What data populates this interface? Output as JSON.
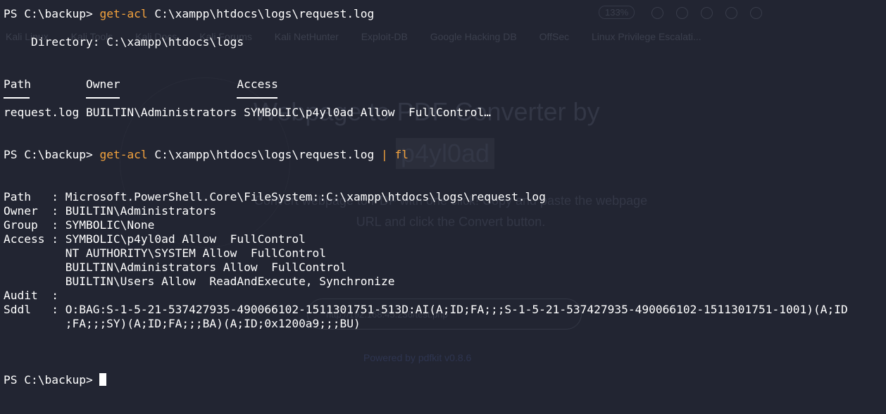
{
  "prompt": "PS C:\\backup> ",
  "command1": {
    "cmdlet": "get-acl",
    "arg": " C:\\xampp\\htdocs\\logs\\request.log"
  },
  "directory_line": "    Directory: C:\\xampp\\htdocs\\logs",
  "table": {
    "headers": [
      "Path",
      "Owner",
      "Access"
    ],
    "row": "request.log BUILTIN\\Administrators SYMBOLIC\\p4yl0ad Allow  FullControl…"
  },
  "command2": {
    "cmdlet": "get-acl",
    "arg": " C:\\xampp\\htdocs\\logs\\request.log ",
    "pipe": "|",
    "format": " fl"
  },
  "fl_output": [
    "Path   : Microsoft.PowerShell.Core\\FileSystem::C:\\xampp\\htdocs\\logs\\request.log",
    "Owner  : BUILTIN\\Administrators",
    "Group  : SYMBOLIC\\None",
    "Access : SYMBOLIC\\p4yl0ad Allow  FullControl",
    "         NT AUTHORITY\\SYSTEM Allow  FullControl",
    "         BUILTIN\\Administrators Allow  FullControl",
    "         BUILTIN\\Users Allow  ReadAndExecute, Synchronize",
    "Audit  :",
    "Sddl   : O:BAG:S-1-5-21-537427935-490066102-1511301751-513D:AI(A;ID;FA;;;S-1-5-21-537427935-490066102-1511301751-1001)(A;ID",
    "         ;FA;;;SY)(A;ID;FA;;;BA)(A;ID;0x1200a9;;;BU)"
  ],
  "background_browser": {
    "zoom": "133%",
    "bookmarks": [
      "Kali Linux",
      "Kali Tools",
      "Kali Docs",
      "Kali Forums",
      "Kali NetHunter",
      "Exploit-DB",
      "Google Hacking DB",
      "OffSec",
      "Linux Privilege Escalati..."
    ],
    "page_title": "Webpage to PDF Converter by",
    "page_name": "p4yl0ad",
    "page_desc_1": "Convert webpage to PDF with one click! Copy and paste the webpage",
    "page_desc_2": "URL and click the Convert button.",
    "input_value": "http://192.168.45.236/test.php",
    "footer": "Powered by pdfkit v0.8.6"
  },
  "colors": {
    "background": "#222532",
    "text": "#ffffff",
    "cmdlet": "#f5a33d"
  },
  "icons": [
    "block-cursor-icon"
  ]
}
